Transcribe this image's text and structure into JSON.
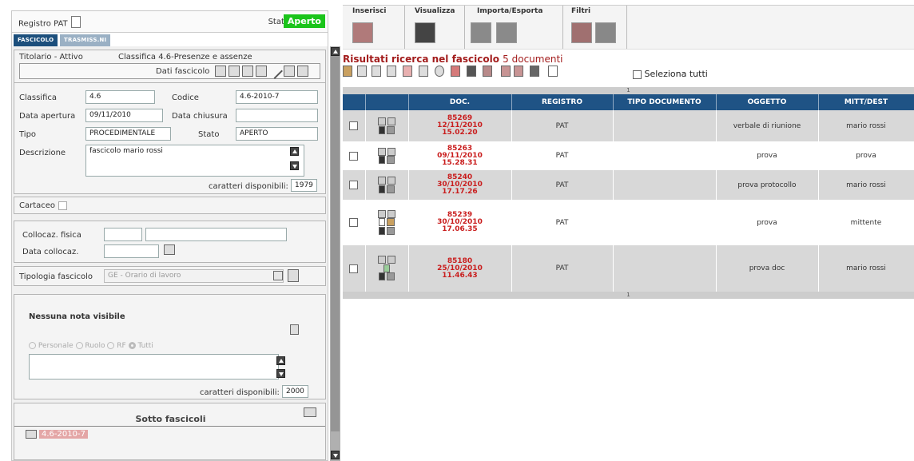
{
  "registro": {
    "label": "Registro PAT",
    "stato_label": "Stato",
    "stato_value": "Aperto"
  },
  "tabs": [
    {
      "label": "FASCICOLO"
    },
    {
      "label": "TRASMISS.NI"
    }
  ],
  "header": {
    "titolario": "Titolario - Attivo",
    "classifica": "Classifica 4.6-Presenze e assenze",
    "dati_fascicolo": "Dati fascicolo"
  },
  "form": {
    "classifica_label": "Classifica",
    "classifica_value": "4.6",
    "codice_label": "Codice",
    "codice_value": "4.6-2010-7",
    "data_apertura_label": "Data apertura",
    "data_apertura_value": "09/11/2010",
    "data_chiusura_label": "Data chiusura",
    "data_chiusura_value": "",
    "tipo_label": "Tipo",
    "tipo_value": "PROCEDIMENTALE",
    "stato_label": "Stato",
    "stato_value": "APERTO",
    "descrizione_label": "Descrizione",
    "descrizione_value": "fascicolo mario rossi",
    "caratteri_label": "caratteri disponibili:",
    "caratteri_value": "1979"
  },
  "cartaceo": {
    "label": "Cartaceo"
  },
  "collocazione": {
    "fisica_label": "Collocaz. fisica",
    "data_label": "Data collocaz."
  },
  "tipologia": {
    "label": "Tipologia fascicolo",
    "value": "GE - Orario di lavoro"
  },
  "note": {
    "nessuna": "Nessuna nota visibile",
    "radios": [
      "Personale",
      "Ruolo",
      "RF",
      "Tutti"
    ],
    "caratteri_label": "caratteri disponibili:",
    "caratteri_value": "2000"
  },
  "sotto": {
    "title": "Sotto fascicoli",
    "item": "4.6-2010-7"
  },
  "menu": {
    "inserisci": "Inserisci",
    "visualizza": "Visualizza",
    "importa": "Importa/Esporta",
    "filtri": "Filtri"
  },
  "results": {
    "title": "Risultati ricerca nel fascicolo",
    "count": "5 documenti",
    "select_all": "Seleziona tutti",
    "page": "1"
  },
  "table": {
    "columns": [
      "DOC.",
      "REGISTRO",
      "TIPO DOCUMENTO",
      "OGGETTO",
      "MITT/DEST"
    ],
    "rows": [
      {
        "num": "85269",
        "date": "12/11/2010",
        "time": "15.02.20",
        "registro": "PAT",
        "tipo": "",
        "oggetto": "verbale di riunione",
        "mitt": "mario rossi"
      },
      {
        "num": "85263",
        "date": "09/11/2010",
        "time": "15.28.31",
        "registro": "PAT",
        "tipo": "",
        "oggetto": "prova",
        "mitt": "prova"
      },
      {
        "num": "85240",
        "date": "30/10/2010",
        "time": "17.17.26",
        "registro": "PAT",
        "tipo": "",
        "oggetto": "prova protocollo",
        "mitt": "mario rossi"
      },
      {
        "num": "85239",
        "date": "30/10/2010",
        "time": "17.06.35",
        "registro": "PAT",
        "tipo": "",
        "oggetto": "prova",
        "mitt": "mittente"
      },
      {
        "num": "85180",
        "date": "25/10/2010",
        "time": "11.46.43",
        "registro": "PAT",
        "tipo": "",
        "oggetto": "prova doc",
        "mitt": "mario rossi"
      }
    ]
  },
  "colors": {
    "header": "#1f5385",
    "accent_red": "#c91d1d",
    "stato_green": "#1ac41a"
  }
}
